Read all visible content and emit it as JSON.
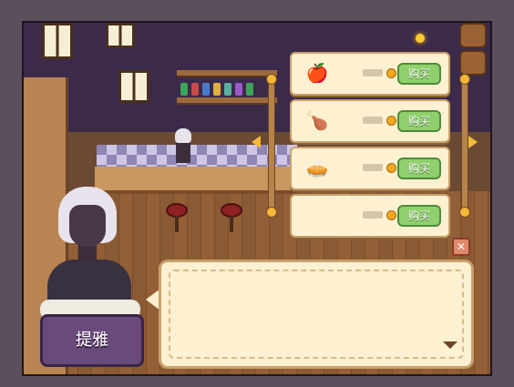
{
  "shop": {
    "items": [
      {
        "icon": "🍎",
        "icon_name": "fruit-plate-icon",
        "buy_label": "购买"
      },
      {
        "icon": "🍗",
        "icon_name": "roast-chicken-icon",
        "buy_label": "购买"
      },
      {
        "icon": "🥧",
        "icon_name": "pie-icon",
        "buy_label": "购买"
      },
      {
        "icon": "",
        "icon_name": "empty-slot",
        "buy_label": "购买"
      }
    ]
  },
  "dialog": {
    "speaker": "提雅",
    "text": ""
  },
  "colors": {
    "buy_button": "#8fd06c",
    "panel_bg": "#fdf1d2",
    "name_plate": "#6a4a7a",
    "coin": "#f2a81e"
  }
}
